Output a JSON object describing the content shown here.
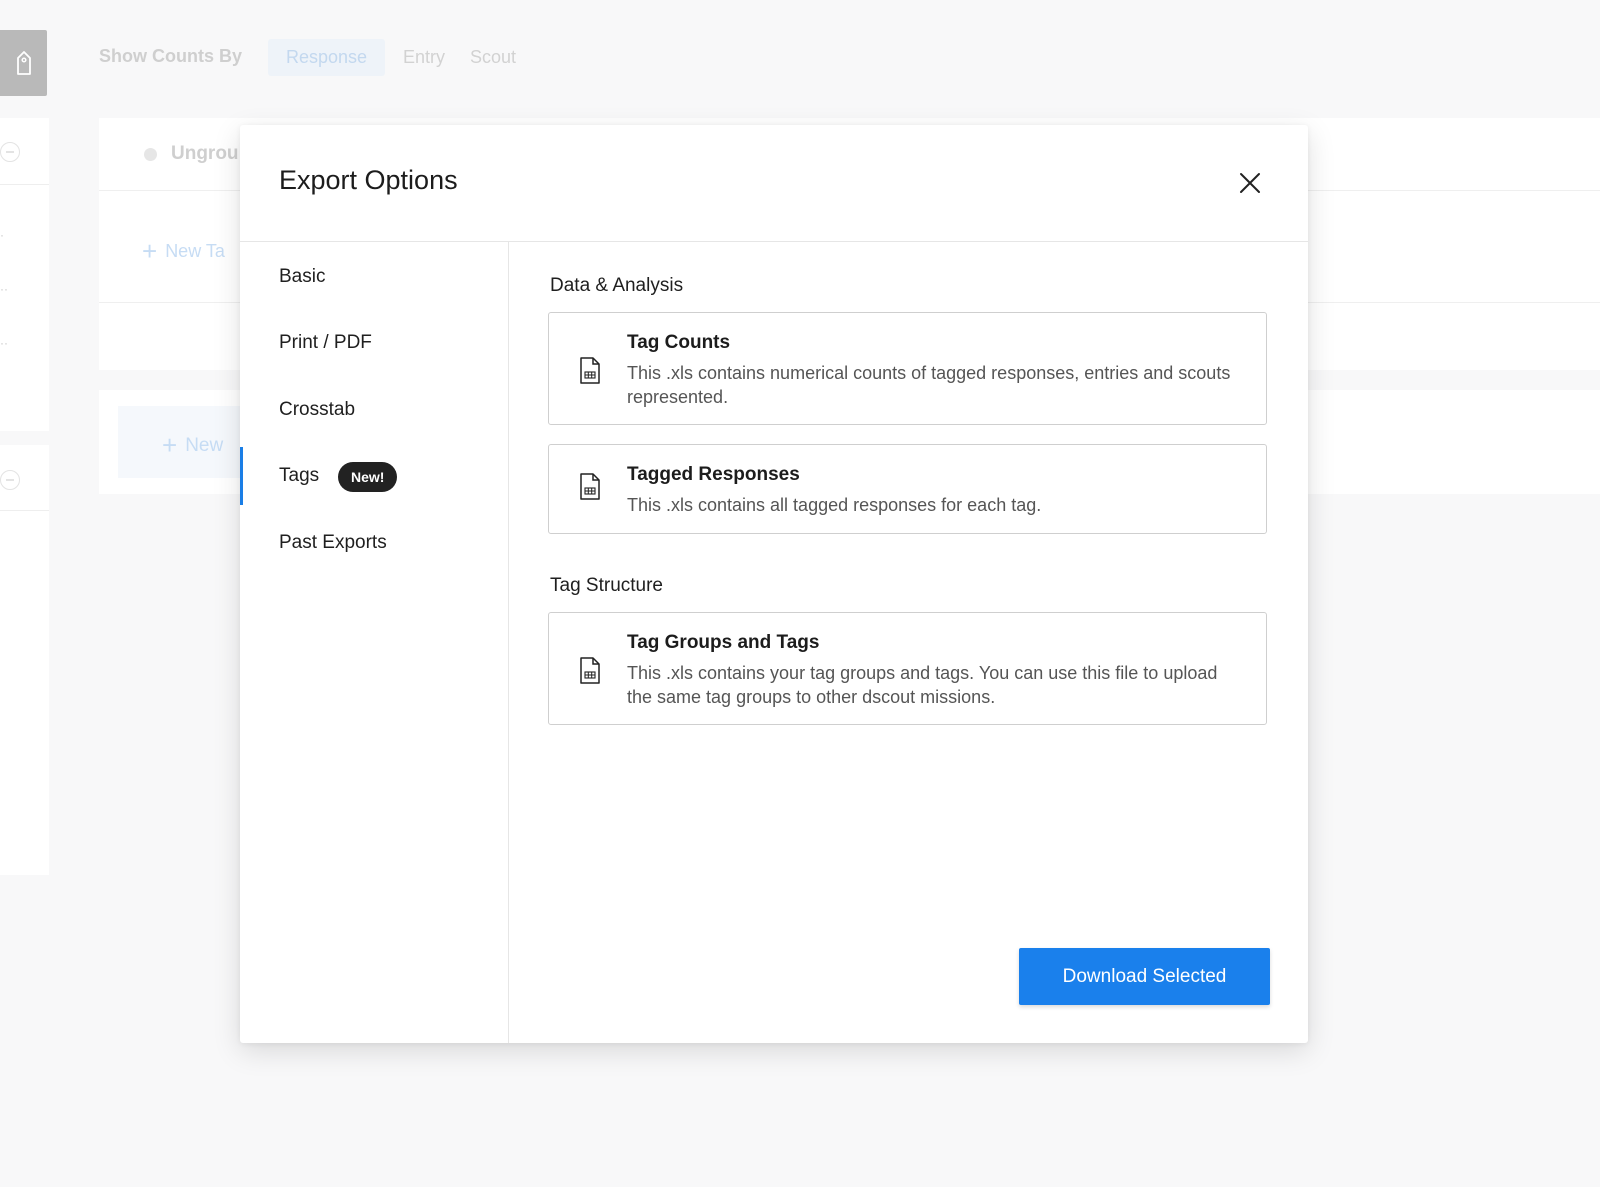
{
  "background": {
    "show_counts_label": "Show Counts By",
    "count_options": [
      "Response",
      "Entry",
      "Scout"
    ],
    "active_count_option": "Response",
    "group_name": "Ungrou",
    "new_tag_label": "New Ta",
    "new_group_label": "New",
    "sidebar_dots": [
      "·",
      "··",
      "··"
    ]
  },
  "modal": {
    "title": "Export Options",
    "close_icon": "close-icon",
    "nav": {
      "items": [
        {
          "label": "Basic"
        },
        {
          "label": "Print / PDF"
        },
        {
          "label": "Crosstab"
        },
        {
          "label": "Tags",
          "badge": "New!"
        },
        {
          "label": "Past Exports"
        }
      ],
      "active": "Tags"
    },
    "sections": [
      {
        "title": "Data & Analysis",
        "options": [
          {
            "title": "Tag Counts",
            "description": "This .xls contains numerical counts of tagged responses, entries and scouts represented.",
            "icon": "spreadsheet-file-icon"
          },
          {
            "title": "Tagged Responses",
            "description": "This .xls contains all tagged responses for each tag.",
            "icon": "spreadsheet-file-icon"
          }
        ]
      },
      {
        "title": "Tag Structure",
        "options": [
          {
            "title": "Tag Groups and Tags",
            "description": "This .xls contains your tag groups and tags. You can use this file to upload the same tag groups to other dscout missions.",
            "icon": "spreadsheet-file-icon"
          }
        ]
      }
    ],
    "download_label": "Download Selected"
  },
  "colors": {
    "accent": "#1a80ec",
    "badge_bg": "#222222",
    "card_border": "#cfcfcf"
  }
}
